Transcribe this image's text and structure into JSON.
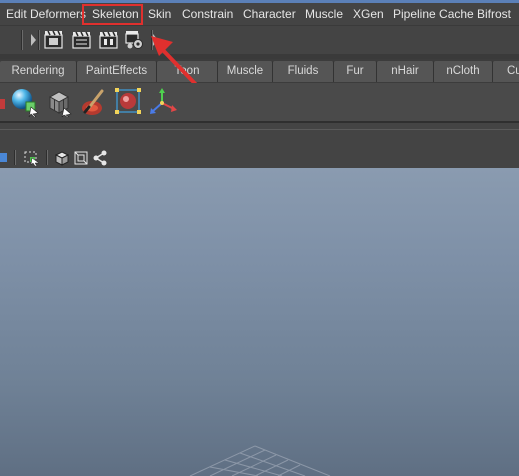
{
  "menu": {
    "items": [
      "Edit Deformers",
      "Skeleton",
      "Skin",
      "Constrain",
      "Character",
      "Muscle",
      "XGen",
      "Pipeline Cache",
      "Bifrost"
    ],
    "highlighted": "Skeleton",
    "highlight_color": "#e0302e"
  },
  "status_line": {
    "icons": [
      "render-frame-icon",
      "render-sequence-icon",
      "ipr-render-icon",
      "render-settings-icon"
    ]
  },
  "shelf": {
    "tabs": [
      "Rendering",
      "PaintEffects",
      "Toon",
      "Muscle",
      "Fluids",
      "Fur",
      "nHair",
      "nCloth",
      "Cu"
    ],
    "icons": [
      "sphere-icon",
      "cube-icon",
      "paint-brush-icon",
      "manipulator-icon",
      "axis-icon"
    ]
  },
  "panel_toolbar": {
    "icons": [
      "camera-icon",
      "select-icon",
      "wireframe-cube-icon",
      "shaded-cube-icon",
      "share-icon"
    ]
  },
  "annotation": {
    "arrow_color": "#e0302e"
  }
}
